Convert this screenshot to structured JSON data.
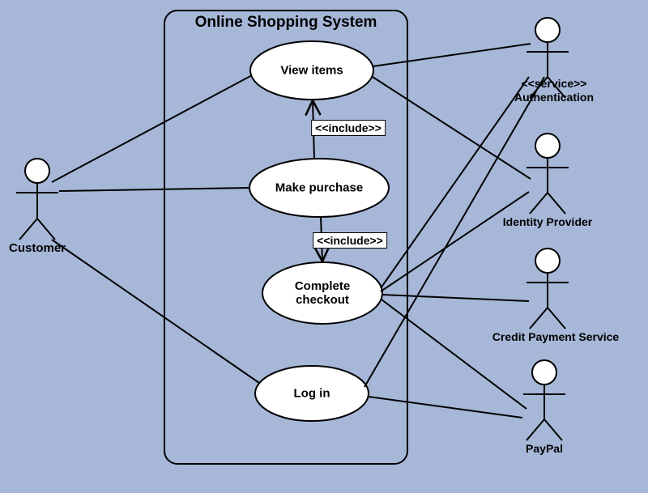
{
  "system": {
    "title": "Online Shopping System"
  },
  "usecases": {
    "view_items": "View items",
    "make_purchase": "Make purchase",
    "complete_checkout": "Complete\ncheckout",
    "log_in": "Log in"
  },
  "actors": {
    "customer": "Customer",
    "authentication": {
      "stereotype": "<<service>>",
      "name": "Authentication"
    },
    "identity_provider": "Identity Provider",
    "credit_payment_service": "Credit Payment Service",
    "paypal": "PayPal"
  },
  "relations": {
    "include1": "<<include>>",
    "include2": "<<include>>"
  }
}
